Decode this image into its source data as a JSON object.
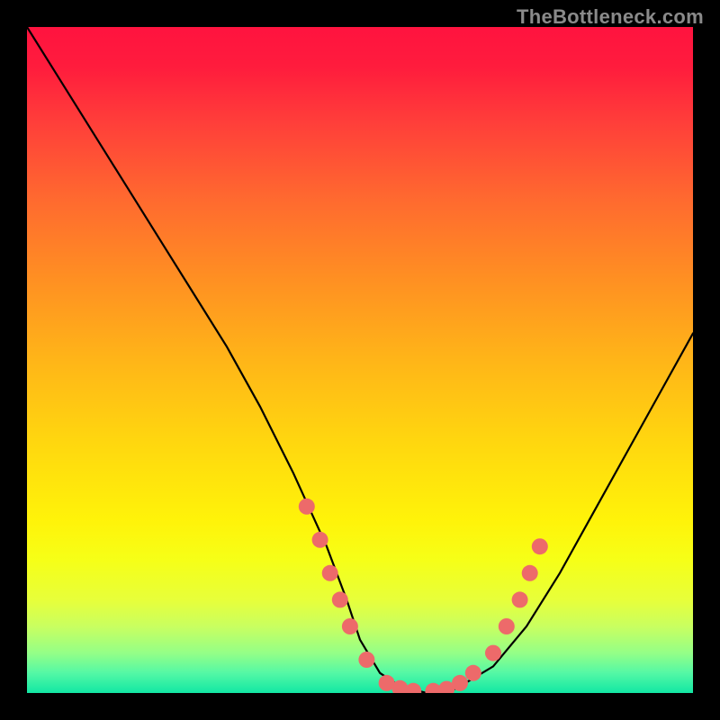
{
  "watermark": "TheBottleneck.com",
  "chart_data": {
    "type": "line",
    "title": "",
    "xlabel": "",
    "ylabel": "",
    "xlim": [
      0,
      100
    ],
    "ylim": [
      0,
      100
    ],
    "series": [
      {
        "name": "curve",
        "x": [
          0,
          5,
          10,
          15,
          20,
          25,
          30,
          35,
          40,
          45,
          48,
          50,
          53,
          56,
          60,
          63,
          65,
          70,
          75,
          80,
          85,
          90,
          95,
          100
        ],
        "y": [
          100,
          92,
          84,
          76,
          68,
          60,
          52,
          43,
          33,
          22,
          14,
          8,
          3,
          1,
          0,
          0,
          1,
          4,
          10,
          18,
          27,
          36,
          45,
          54
        ]
      }
    ],
    "markers": {
      "name": "highlight-dots",
      "color": "#ed6a6a",
      "points": [
        {
          "x": 42,
          "y": 28
        },
        {
          "x": 44,
          "y": 23
        },
        {
          "x": 45.5,
          "y": 18
        },
        {
          "x": 47,
          "y": 14
        },
        {
          "x": 48.5,
          "y": 10
        },
        {
          "x": 51,
          "y": 5
        },
        {
          "x": 54,
          "y": 1.5
        },
        {
          "x": 56,
          "y": 0.7
        },
        {
          "x": 58,
          "y": 0.3
        },
        {
          "x": 61,
          "y": 0.3
        },
        {
          "x": 63,
          "y": 0.6
        },
        {
          "x": 65,
          "y": 1.5
        },
        {
          "x": 67,
          "y": 3
        },
        {
          "x": 70,
          "y": 6
        },
        {
          "x": 72,
          "y": 10
        },
        {
          "x": 74,
          "y": 14
        },
        {
          "x": 75.5,
          "y": 18
        },
        {
          "x": 77,
          "y": 22
        }
      ]
    },
    "gradient_stops": [
      {
        "pos": 0.0,
        "color": "#ff133f"
      },
      {
        "pos": 0.5,
        "color": "#ffd60f"
      },
      {
        "pos": 0.8,
        "color": "#f6ff17"
      },
      {
        "pos": 1.0,
        "color": "#12e7a4"
      }
    ]
  }
}
